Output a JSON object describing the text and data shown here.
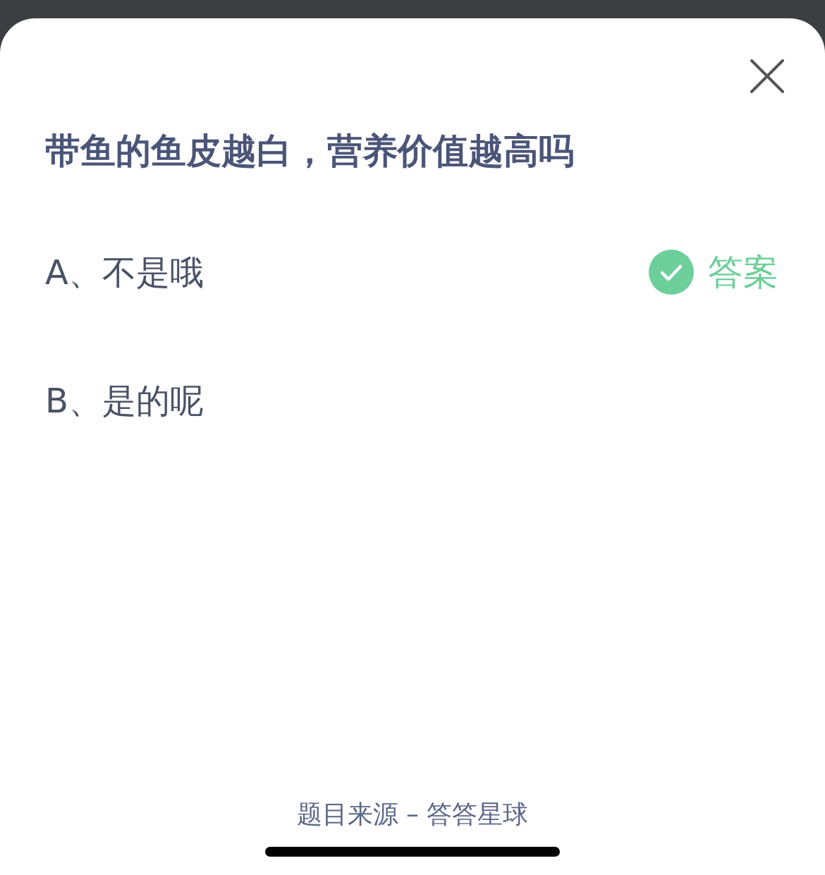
{
  "question": {
    "title": "带鱼的鱼皮越白，营养价值越高吗"
  },
  "options": [
    {
      "label": "A、不是哦",
      "correct": true
    },
    {
      "label": "B、是的呢",
      "correct": false
    }
  ],
  "answer_label": "答案",
  "source": "题目来源 – 答答星球"
}
